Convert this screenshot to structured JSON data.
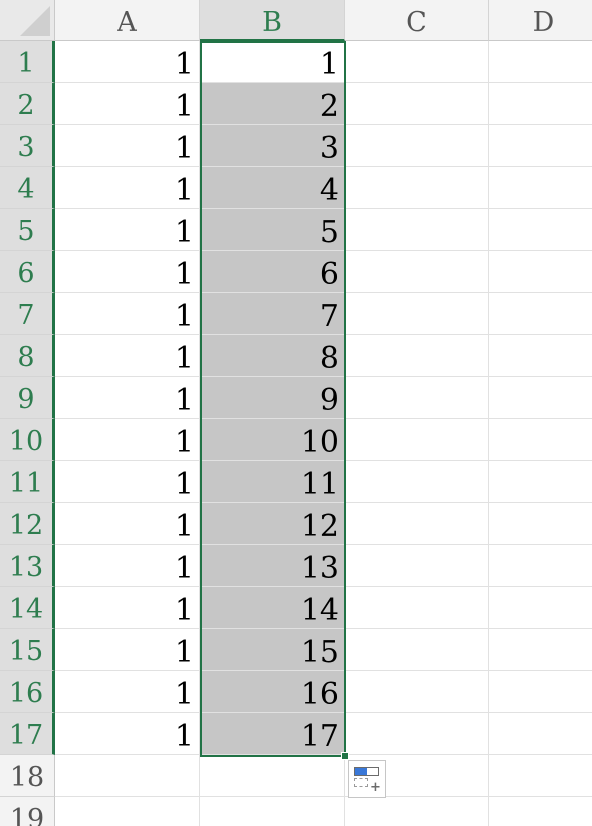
{
  "columns": [
    {
      "label": "A",
      "selected": false
    },
    {
      "label": "B",
      "selected": true
    },
    {
      "label": "C",
      "selected": false
    },
    {
      "label": "D",
      "selected": false
    }
  ],
  "rows": [
    {
      "label": "1",
      "a": "1",
      "b": "1"
    },
    {
      "label": "2",
      "a": "1",
      "b": "2"
    },
    {
      "label": "3",
      "a": "1",
      "b": "3"
    },
    {
      "label": "4",
      "a": "1",
      "b": "4"
    },
    {
      "label": "5",
      "a": "1",
      "b": "5"
    },
    {
      "label": "6",
      "a": "1",
      "b": "6"
    },
    {
      "label": "7",
      "a": "1",
      "b": "7"
    },
    {
      "label": "8",
      "a": "1",
      "b": "8"
    },
    {
      "label": "9",
      "a": "1",
      "b": "9"
    },
    {
      "label": "10",
      "a": "1",
      "b": "10"
    },
    {
      "label": "11",
      "a": "1",
      "b": "11"
    },
    {
      "label": "12",
      "a": "1",
      "b": "12"
    },
    {
      "label": "13",
      "a": "1",
      "b": "13"
    },
    {
      "label": "14",
      "a": "1",
      "b": "14"
    },
    {
      "label": "15",
      "a": "1",
      "b": "15"
    },
    {
      "label": "16",
      "a": "1",
      "b": "16"
    },
    {
      "label": "17",
      "a": "1",
      "b": "17"
    },
    {
      "label": "18",
      "a": "",
      "b": ""
    },
    {
      "label": "19",
      "a": "",
      "b": ""
    }
  ],
  "selection": {
    "column": "B",
    "first_row": 1,
    "last_row": 17,
    "active_row": 1
  },
  "colors": {
    "accent": "#217346",
    "selection_fill": "#c6c6c6",
    "autofill_icon": "#3a78d8"
  },
  "autofill_options": {
    "icon": "autofill-options-icon"
  }
}
